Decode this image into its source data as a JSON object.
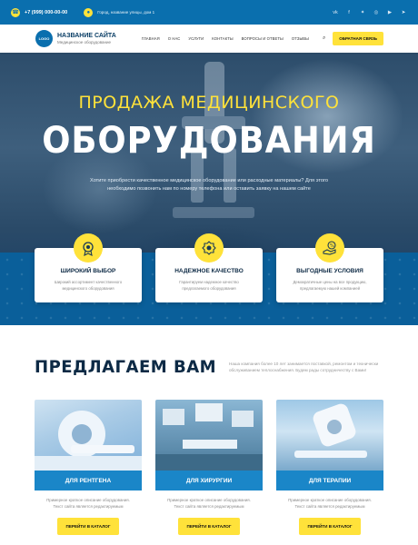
{
  "topbar": {
    "phone": "+7 (999) 000-00-00",
    "address": "Город, название улицы, дом 1",
    "social_icons": [
      "vk-icon",
      "facebook-icon",
      "twitter-icon",
      "odnoklassniki-icon",
      "youtube-icon",
      "telegram-icon"
    ]
  },
  "header": {
    "logo_text": "LOGO",
    "site_name": "НАЗВАНИЕ САЙТА",
    "site_subtitle": "Медицинское оборудование",
    "nav": [
      "Главная",
      "О нас",
      "Услуги",
      "Контакты",
      "Вопросы и ответы",
      "Отзывы"
    ],
    "cta": "Обратная связь"
  },
  "hero": {
    "title_line1": "ПРОДАЖА МЕДИЦИНСКОГО",
    "title_line2": "ОБОРУДОВАНИЯ",
    "paragraph": "Хотите приобрести качественное медицинское оборудование или расходные материалы? Для этого необходимо позвонить нам по номеру телефона или оставить заявку на нашем сайте"
  },
  "features": [
    {
      "icon": "medal-icon",
      "title": "ШИРОКИЙ ВЫБОР",
      "desc": "Широкий ассортимент качественного медицинского оборудования"
    },
    {
      "icon": "award-ribbon-icon",
      "title": "НАДЕЖНОЕ КАЧЕСТВО",
      "desc": "Гарантируем надежное качество предлагаемого оборудования"
    },
    {
      "icon": "discount-hand-icon",
      "title": "ВЫГОДНЫЕ УСЛОВИЯ",
      "desc": "Демократичные цены на все продукцию, предлагаемую нашей компанией"
    }
  ],
  "offer": {
    "title": "ПРЕДЛАГАЕМ ВАМ",
    "description": "Наша компания более 10 лет занимается поставкой, ремонтом и технически обслуживанием теплоснабжения. Будем рады сотрудничеству с Вами!"
  },
  "cards": [
    {
      "title": "ДЛЯ РЕНТГЕНА",
      "desc": "Примерное краткое описание оборудования. Текст сайта является редактируемым",
      "button": "ПЕРЕЙТИ В КАТАЛОГ"
    },
    {
      "title": "ДЛЯ ХИРУРГИИ",
      "desc": "Примерное краткое описание оборудования. Текст сайта является редактируемым",
      "button": "ПЕРЕЙТИ В КАТАЛОГ"
    },
    {
      "title": "ДЛЯ ТЕРАПИИ",
      "desc": "Примерное краткое описание оборудования. Текст сайта является редактируемым",
      "button": "ПЕРЕЙТИ В КАТАЛОГ"
    }
  ],
  "colors": {
    "accent_yellow": "#ffe23a",
    "brand_blue": "#0a6fae",
    "card_blue": "#1a86c8",
    "dark_title": "#0d2a45"
  }
}
